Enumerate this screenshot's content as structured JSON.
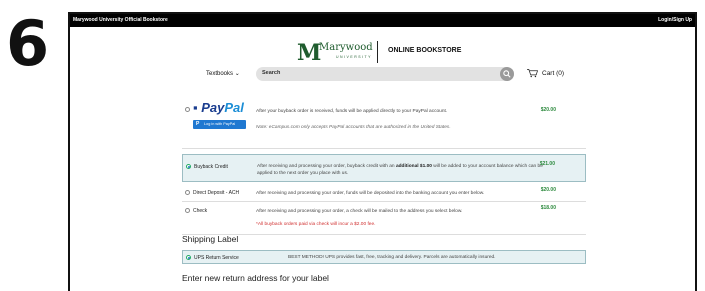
{
  "step_number": "6",
  "topbar": {
    "store_name": "Marywood University Official Bookstore",
    "login": "Login/Sign Up"
  },
  "logo": {
    "m": "M",
    "name": "Marywood",
    "sub": "UNIVERSITY",
    "store": "ONLINE BOOKSTORE"
  },
  "nav": {
    "textbooks": "Textbooks",
    "search_placeholder": "Search",
    "cart": "Cart (0)"
  },
  "options": [
    {
      "id": "paypal",
      "label": "PayPal",
      "label_highlight": "Pal",
      "label_prefix": "Pay",
      "button": "Log in with PayPal",
      "desc": "After your buyback order is received, funds will be applied directly to your PayPal account.",
      "note": "Note: eCampus.com only accepts PayPal accounts that are authorized in the United States.",
      "amount": "$20.00",
      "selected": false
    },
    {
      "id": "buyback",
      "label": "Buyback Credit",
      "desc_pre": "After receiving and processing your order, buyback credit with an",
      "desc_bold": "additional $1.00",
      "desc_post": "will be added to your account balance which can be applied to the next order you place with us.",
      "amount": "$21.00",
      "selected": true
    },
    {
      "id": "ach",
      "label": "Direct Deposit - ACH",
      "desc": "After receiving and processing your order, funds will be deposited into the banking account you enter below.",
      "amount": "$20.00",
      "selected": false
    },
    {
      "id": "check",
      "label": "Check",
      "desc": "After receiving and processing your order, a check will be mailed to the address you select below.",
      "note": "*All buyback orders paid via check will incur a $2.00 fee.",
      "amount": "$18.00",
      "selected": false
    }
  ],
  "shipping": {
    "title": "Shipping Label",
    "option_label": "UPS Return Service",
    "option_desc": "BEST METHOD! UPS provides fast, free, tracking and delivery. Parcels are automatically insured."
  },
  "return_address_title": "Enter new return address for your label"
}
